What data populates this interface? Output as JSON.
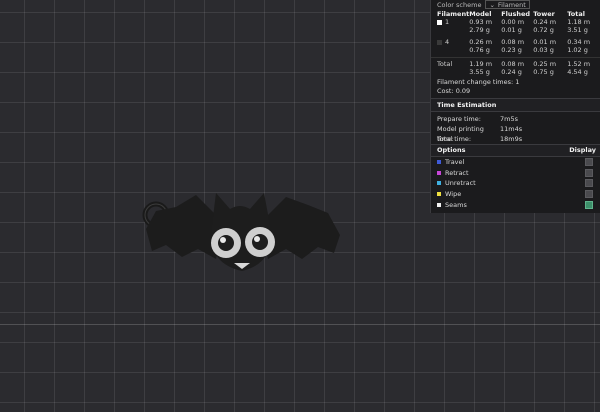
{
  "color_scheme": {
    "label": "Color scheme",
    "value": "Filament"
  },
  "filament_table": {
    "headers": [
      "Filament",
      "Model",
      "Flushed",
      "Tower",
      "Total"
    ],
    "rows": [
      {
        "id": "1",
        "color": "#ffffff",
        "model": [
          "0.93 m",
          "2.79 g"
        ],
        "flushed": [
          "0.00 m",
          "0.01 g"
        ],
        "tower": [
          "0.24 m",
          "0.72 g"
        ],
        "total": [
          "1.18 m",
          "3.51 g"
        ]
      },
      {
        "id": "4",
        "color": "#3a3a3a",
        "model": [
          "0.26 m",
          "0.76 g"
        ],
        "flushed": [
          "0.08 m",
          "0.23 g"
        ],
        "tower": [
          "0.01 m",
          "0.03 g"
        ],
        "total": [
          "0.34 m",
          "1.02 g"
        ]
      }
    ],
    "total": {
      "label": "Total",
      "model": [
        "1.19 m",
        "3.55 g"
      ],
      "flushed": [
        "0.08 m",
        "0.24 g"
      ],
      "tower": [
        "0.25 m",
        "0.75 g"
      ],
      "total": [
        "1.52 m",
        "4.54 g"
      ]
    }
  },
  "change_times": "Filament change times:  1",
  "cost": "Cost:  0.09",
  "time_estimation": {
    "title": "Time Estimation",
    "prepare_label": "Prepare time:",
    "prepare_value": "7m5s",
    "model_label": "Model printing time:",
    "model_value": "11m4s",
    "total_label": "Total time:",
    "total_value": "18m9s"
  },
  "options": {
    "title": "Options",
    "display_label": "Display",
    "items": [
      {
        "label": "Travel",
        "color": "#3f5bd8",
        "checked": false
      },
      {
        "label": "Retract",
        "color": "#c846d8",
        "checked": false
      },
      {
        "label": "Unretract",
        "color": "#3fb0e0",
        "checked": false
      },
      {
        "label": "Wipe",
        "color": "#f0e040",
        "checked": false
      },
      {
        "label": "Seams",
        "color": "#f2f2f2",
        "checked": true
      }
    ]
  }
}
